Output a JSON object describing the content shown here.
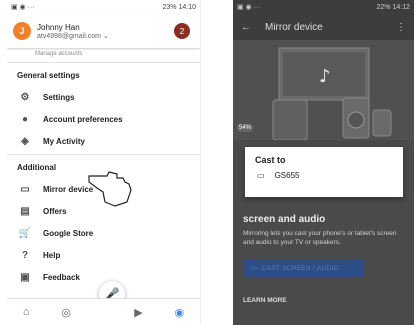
{
  "left": {
    "status": {
      "right": "23% 14:10"
    },
    "account": {
      "initial": "J",
      "name": "Johnny Han",
      "email": "atv4998@gmail.com ⌄",
      "badge": "2"
    },
    "cut_row": "Manage accounts",
    "sections": {
      "general": "General settings",
      "additional": "Additional"
    },
    "items": {
      "settings": "Settings",
      "account_preferences": "Account preferences",
      "my_activity": "My Activity",
      "mirror_device": "Mirror device",
      "offers": "Offers",
      "google_store": "Google Store",
      "help": "Help",
      "feedback": "Feedback"
    }
  },
  "right": {
    "status": {
      "right": "22% 14:12"
    },
    "appbar_title": "Mirror device",
    "percent": "54%",
    "heading": "screen and audio",
    "description": "Mirroring lets you cast your phone's or tablet's screen and audio to your TV or speakers.",
    "cast_button": "CAST SCREEN / AUDIO",
    "learn_more": "LEARN MORE",
    "dialog": {
      "title": "Cast to",
      "device": "GS655"
    }
  },
  "colors": {
    "avatar": "#f0802a",
    "badge": "#8a2c1f",
    "mic": "#4285f4",
    "button": "#2c4d86"
  }
}
